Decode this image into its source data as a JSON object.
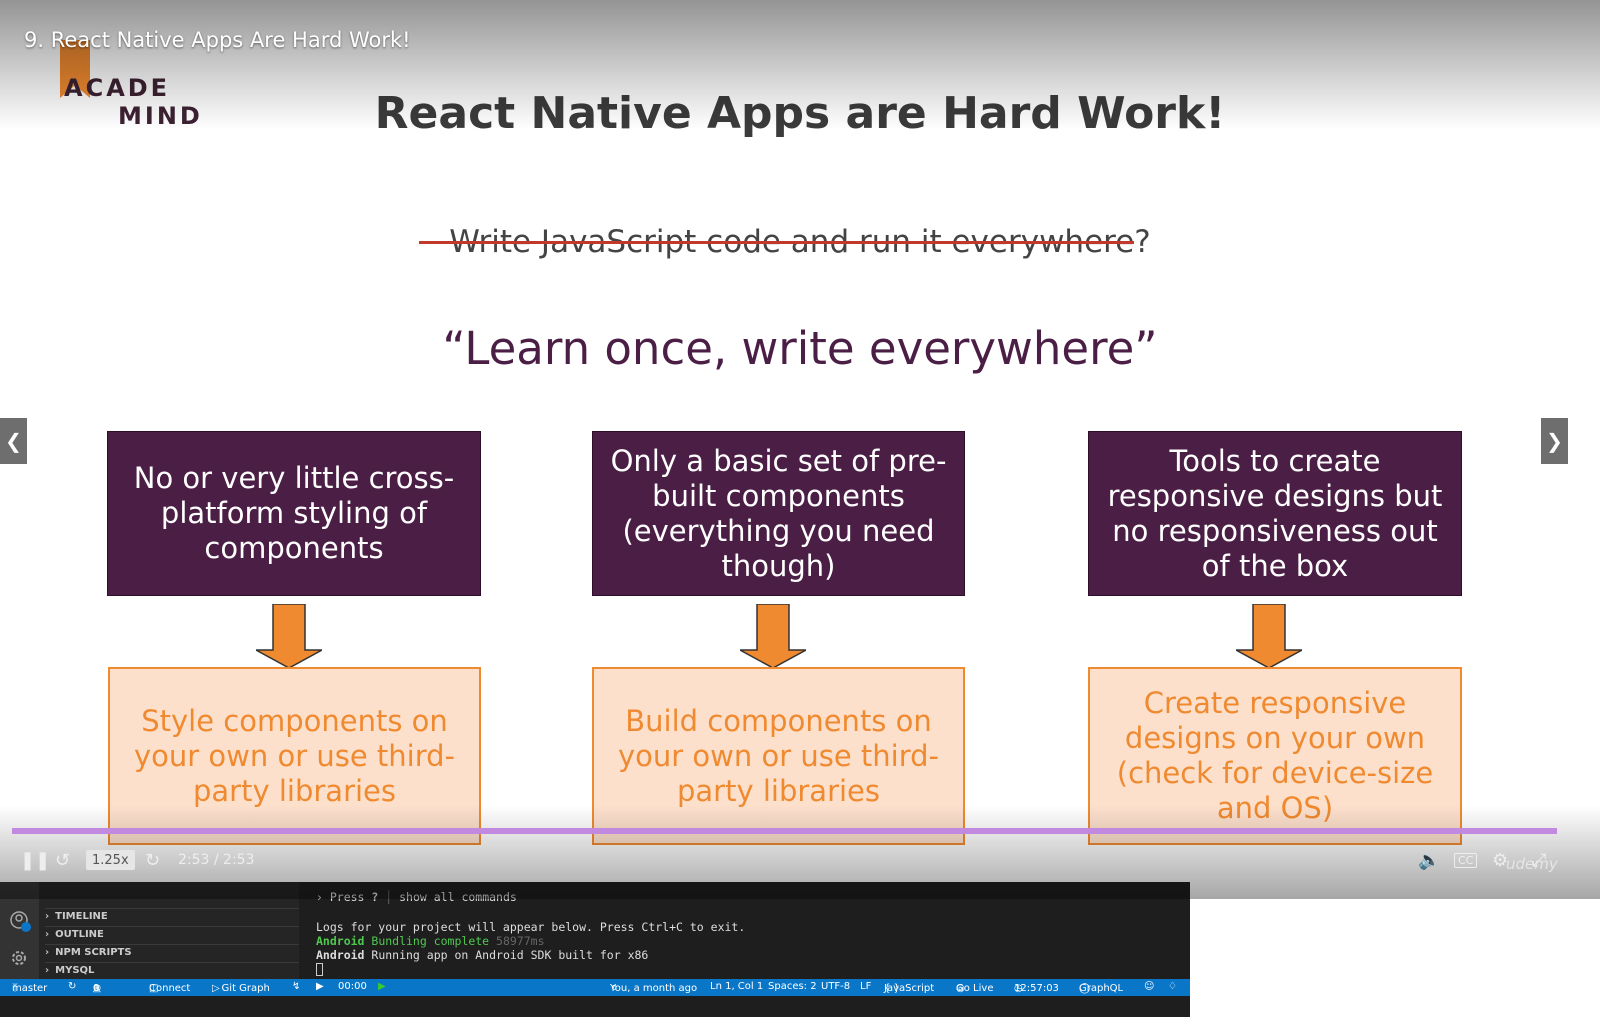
{
  "video": {
    "title": "9. React Native Apps Are Hard Work!",
    "progress_percent": 100,
    "speed": "1.25x",
    "timecode": "2:53 / 2:53"
  },
  "slide": {
    "logo_line1": "ACADE",
    "logo_line2": "MIND",
    "title": "React Native Apps are Hard Work!",
    "struck_text": "Write JavaScript code and run it everywhere",
    "struck_suffix": "?",
    "motto": "“Learn once, write everywhere”",
    "columns": [
      {
        "problem": "No or very little cross-platform styling of components",
        "solution": "Style components on your own or use third-party libraries"
      },
      {
        "problem": "Only a basic set of pre-built components (everything you need though)",
        "solution": "Build components on your own or use third-party libraries"
      },
      {
        "problem": "Tools to create responsive designs but no responsiveness out of the box",
        "solution": "Create responsive designs on your own (check for device-size and OS)"
      }
    ],
    "colors": {
      "problem_bg": "#4b1e45",
      "solution_bg": "#fde0cc",
      "accent": "#f08a30"
    }
  },
  "nav": {
    "prev_icon": "chevron-left-icon",
    "next_icon": "chevron-right-icon"
  },
  "controls": {
    "icons": [
      "pause-icon",
      "rewind-icon",
      "forward-icon",
      "volume-icon",
      "captions-icon",
      "settings-icon",
      "fullscreen-icon"
    ],
    "watermark": "udemy"
  },
  "vscode": {
    "sidebar": [
      "TIMELINE",
      "OUTLINE",
      "NPM SCRIPTS",
      "MYSQL"
    ],
    "terminal": {
      "hint_prefix": "› Press ",
      "hint_key": "?",
      "hint_sep": "│",
      "hint_text": " show all commands",
      "log_line": "Logs for your project will appear below. Press Ctrl+C to exit.",
      "line2_tag": "Android",
      "line2_msg": " Bundling complete ",
      "line2_ms": "58977ms",
      "line3_tag": "Android",
      "line3_msg": " Running app on Android SDK built for x86"
    },
    "status": {
      "branch": "master",
      "errors": "0",
      "warnings": "0",
      "connect": "Connect",
      "git_graph": "Git Graph",
      "timer": "00:00",
      "blame": "You, a month ago",
      "position": "Ln 1, Col 1",
      "spaces": "Spaces: 2",
      "encoding": "UTF-8",
      "eol": "LF",
      "language": "JavaScript",
      "golive": "Go Live",
      "clock": "12:57:03",
      "graphql": "GraphQL"
    }
  }
}
